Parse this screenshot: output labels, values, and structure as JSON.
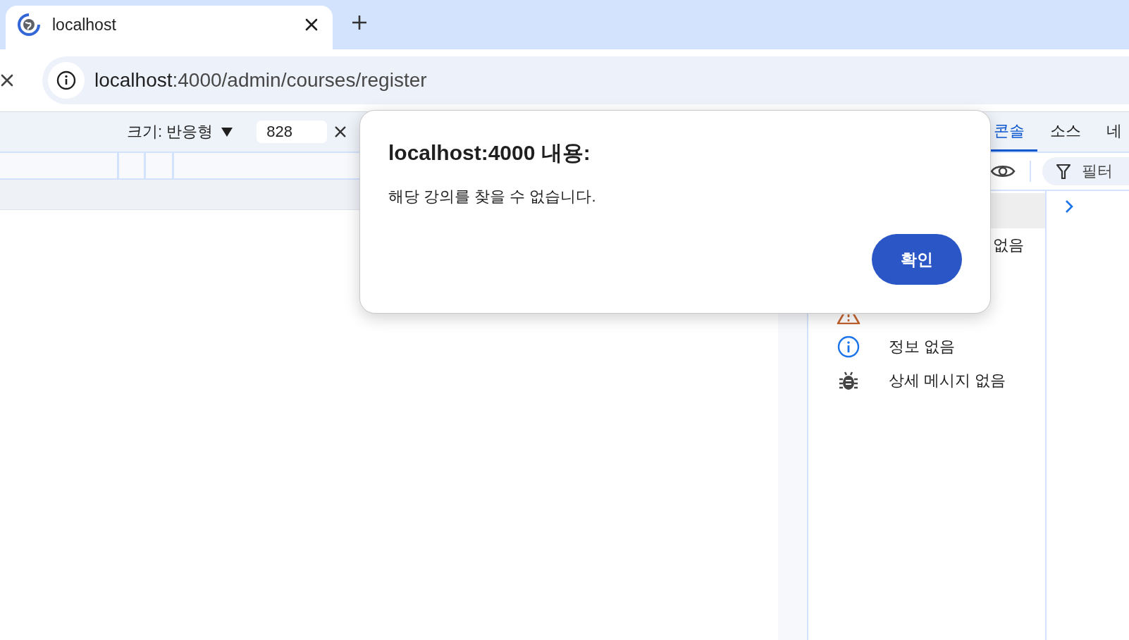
{
  "browser_tab": {
    "title": "localhost",
    "selected": true
  },
  "address_bar": {
    "host": "localhost",
    "path": ":4000/admin/courses/register"
  },
  "device_toolbar": {
    "size_label": "크기: 반응형",
    "width_value": "828"
  },
  "devtools": {
    "tabs": [
      {
        "label": "콘솔",
        "selected": true
      },
      {
        "label": "소스",
        "selected": false
      },
      {
        "label": "네",
        "selected": false
      }
    ],
    "filter_placeholder": "필터",
    "sidebar_items": [
      {
        "kind": "partial",
        "label": "없음"
      },
      {
        "kind": "warning"
      },
      {
        "kind": "info",
        "label": "정보 없음"
      },
      {
        "kind": "verbose",
        "label": "상세 메시지 없음"
      }
    ]
  },
  "alert_dialog": {
    "title": "localhost:4000 내용:",
    "message": "해당 강의를 찾을 수 없습니다.",
    "button": "확인"
  }
}
